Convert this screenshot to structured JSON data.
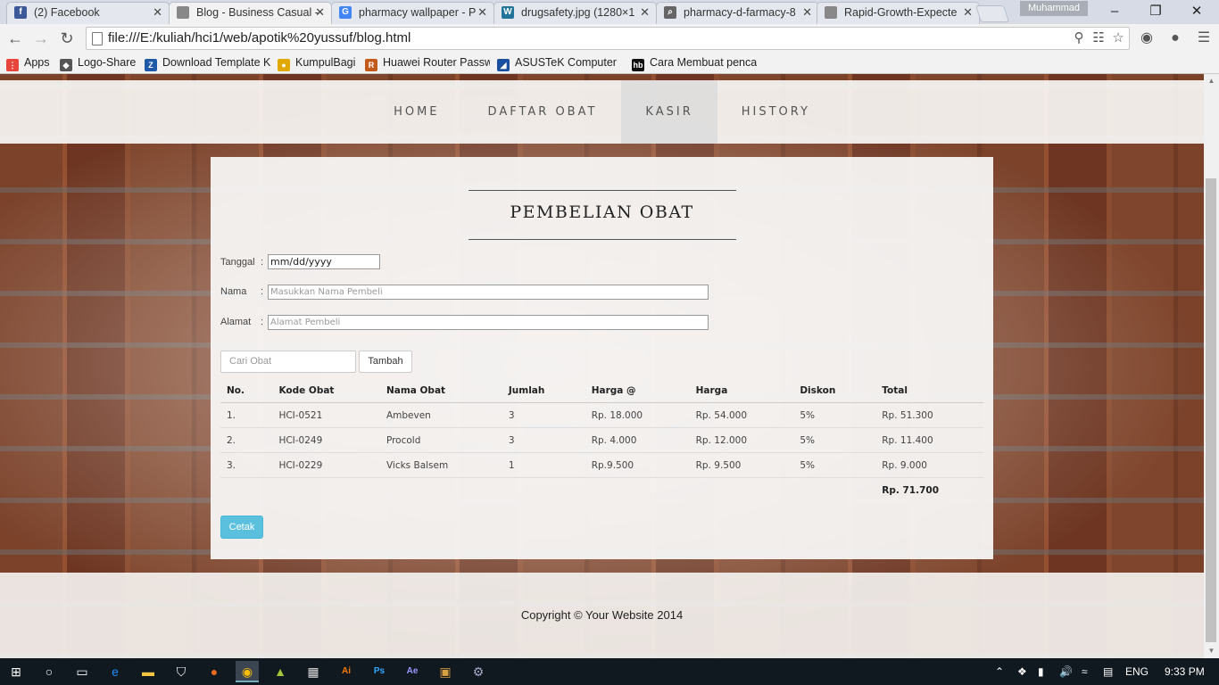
{
  "browser": {
    "tabs": [
      {
        "title": "(2) Facebook",
        "icon": "facebook-icon",
        "color": "#3b5998",
        "glyph": "f"
      },
      {
        "title": "Blog - Business Casual - ",
        "icon": "page-icon",
        "color": "#888888",
        "glyph": ""
      },
      {
        "title": "pharmacy wallpaper - P",
        "icon": "google-icon",
        "color": "#4285f4",
        "glyph": "G"
      },
      {
        "title": "drugsafety.jpg (1280×1",
        "icon": "wordpress-icon",
        "color": "#21759b",
        "glyph": "W"
      },
      {
        "title": "pharmacy-d-farmacy-8",
        "icon": "search-icon",
        "color": "#666666",
        "glyph": "⌕"
      },
      {
        "title": "Rapid-Growth-Expecte",
        "icon": "page-icon",
        "color": "#888888",
        "glyph": ""
      }
    ],
    "profile_name": "Muhammad",
    "url": "file:///E:/kuliah/hci1/web/apotik%20yussuf/blog.html",
    "bookmarks": [
      {
        "label": "Apps",
        "icon": "apps-grid-icon",
        "color": "#e8453c",
        "glyph": "⋮"
      },
      {
        "label": "Logo-Share",
        "icon": "logo-share-icon",
        "color": "#555555",
        "glyph": "◆"
      },
      {
        "label": "Download Template K",
        "icon": "template-icon",
        "color": "#1e5aa8",
        "glyph": "Z"
      },
      {
        "label": "KumpulBagi",
        "icon": "kumpulbagi-icon",
        "color": "#e0a800",
        "glyph": "●"
      },
      {
        "label": "Huawei Router Passw",
        "icon": "huawei-icon",
        "color": "#c45a1a",
        "glyph": "R"
      },
      {
        "label": "ASUSTeK Computer In",
        "icon": "asus-icon",
        "color": "#1d4fa0",
        "glyph": "◢"
      },
      {
        "label": "Cara Membuat penca",
        "icon": "blog-icon",
        "color": "#111111",
        "glyph": "hb"
      }
    ]
  },
  "site": {
    "nav": [
      "HOME",
      "DAFTAR OBAT",
      "KASIR",
      "HISTORY"
    ],
    "active_nav": "KASIR",
    "title": "PEMBELIAN OBAT",
    "form": {
      "tanggal_label": "Tanggal",
      "tanggal_value": "mm/dd/yyyy",
      "nama_label": "Nama",
      "nama_placeholder": "Masukkan Nama Pembeli",
      "alamat_label": "Alamat",
      "alamat_placeholder": "Alamat Pembeli",
      "colon": ":"
    },
    "search_placeholder": "Cari Obat",
    "add_button": "Tambah",
    "table": {
      "headers": [
        "No.",
        "Kode Obat",
        "Nama Obat",
        "Jumlah",
        "Harga @",
        "Harga",
        "Diskon",
        "Total"
      ],
      "rows": [
        [
          "1.",
          "HCI-0521",
          "Ambeven",
          "3",
          "Rp. 18.000",
          "Rp. 54.000",
          "5%",
          "Rp. 51.300"
        ],
        [
          "2.",
          "HCI-0249",
          "Procold",
          "3",
          "Rp. 4.000",
          "Rp. 12.000",
          "5%",
          "Rp. 11.400"
        ],
        [
          "3.",
          "HCI-0229",
          "Vicks Balsem",
          "1",
          "Rp.9.500",
          "Rp. 9.500",
          "5%",
          "Rp. 9.000"
        ]
      ],
      "grand_total": "Rp. 71.700"
    },
    "print_button": "Cetak",
    "footer": "Copyright © Your Website 2014",
    "accent_color": "#5bc0de"
  },
  "taskbar": {
    "apps": [
      "windows-start-icon",
      "cortana-icon",
      "task-view-icon",
      "edge-icon",
      "file-explorer-icon",
      "store-icon",
      "firefox-icon",
      "chrome-icon",
      "android-studio-icon",
      "film-icon",
      "illustrator-icon",
      "photoshop-icon",
      "after-effects-icon",
      "archive-icon",
      "settings-icon"
    ],
    "language": "ENG",
    "time": "9:33 PM"
  }
}
